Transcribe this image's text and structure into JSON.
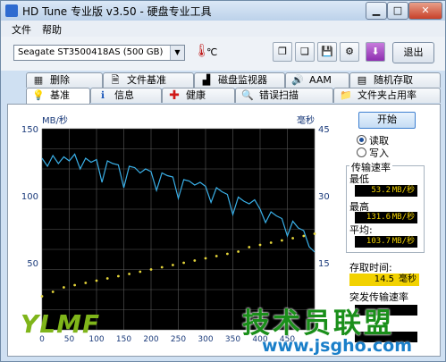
{
  "window": {
    "title": "HD Tune 专业版 v3.50 - 硬盘专业工具"
  },
  "menu": {
    "file": "文件",
    "help": "帮助"
  },
  "toolbar": {
    "drive": "Seagate ST3500418AS (500 GB)",
    "temperature_unit": "℃",
    "exit_label": "退出",
    "thermometer_icon": "thermometer-icon"
  },
  "tabs_top": [
    {
      "label": "删除",
      "icon": "delete-icon"
    },
    {
      "label": "文件基准",
      "icon": "file-benchmark-icon"
    },
    {
      "label": "磁盘监视器",
      "icon": "disk-monitor-icon"
    },
    {
      "label": "AAM",
      "icon": "speaker-icon"
    },
    {
      "label": "随机存取",
      "icon": "random-access-icon"
    }
  ],
  "tabs_bottom": [
    {
      "label": "基准",
      "icon": "bulb-icon"
    },
    {
      "label": "信息",
      "icon": "info-icon"
    },
    {
      "label": "健康",
      "icon": "health-cross-icon"
    },
    {
      "label": "错误扫描",
      "icon": "magnifier-icon"
    },
    {
      "label": "文件夹占用率",
      "icon": "folder-icon"
    }
  ],
  "side": {
    "start": "开始",
    "read": "读取",
    "write": "写入",
    "transfer_rate_title": "传输速率",
    "min_label": "最低",
    "min_value": "53.2",
    "max_label": "最高",
    "max_value": "131.6",
    "avg_label": "平均:",
    "avg_value": "103.7",
    "rate_unit": "MB/秒",
    "access_time_label": "存取时间:",
    "access_time_value": "14.5",
    "access_time_unit": "毫秒",
    "burst_rate_label": "突发传输速率"
  },
  "chart_data": {
    "type": "line",
    "left_axis_unit": "MB/秒",
    "right_axis_unit": "毫秒",
    "y_left_range": [
      0,
      150
    ],
    "y_left_ticks": [
      50,
      100,
      150
    ],
    "y_right_range": [
      0,
      45
    ],
    "y_right_ticks": [
      15,
      30,
      45
    ],
    "x_range": [
      0,
      500
    ],
    "x_ticks": [
      0,
      50,
      100,
      150,
      200,
      250,
      300,
      350,
      400,
      450
    ],
    "grid": true,
    "series": [
      {
        "role": "transfer rate (left axis)",
        "color": "#3ab0e8",
        "x": [
          0,
          10,
          20,
          30,
          40,
          50,
          60,
          70,
          80,
          90,
          100,
          110,
          120,
          130,
          140,
          150,
          160,
          170,
          180,
          190,
          200,
          210,
          220,
          230,
          240,
          250,
          260,
          270,
          280,
          290,
          300,
          310,
          320,
          330,
          340,
          350,
          360,
          370,
          380,
          390,
          400,
          410,
          420,
          430,
          440,
          450,
          460,
          470,
          480,
          490,
          500
        ],
        "y": [
          128,
          122,
          130,
          124,
          129,
          126,
          131,
          120,
          128,
          125,
          127,
          110,
          126,
          124,
          123,
          106,
          122,
          121,
          117,
          120,
          118,
          104,
          117,
          115,
          114,
          98,
          112,
          111,
          108,
          110,
          107,
          95,
          106,
          103,
          101,
          86,
          99,
          96,
          94,
          97,
          90,
          80,
          88,
          85,
          83,
          70,
          81,
          76,
          74,
          62,
          58
        ]
      },
      {
        "role": "access time (right axis)",
        "color": "#e6d63a",
        "marker": "dot",
        "x": [
          0,
          20,
          40,
          60,
          80,
          100,
          120,
          140,
          160,
          180,
          200,
          220,
          240,
          260,
          280,
          300,
          320,
          340,
          360,
          380,
          400,
          420,
          440,
          460,
          480,
          500
        ],
        "y": [
          7.5,
          8.5,
          9.5,
          10,
          10.5,
          11,
          11.5,
          12,
          12.5,
          13,
          13.5,
          14,
          14.5,
          15,
          15.5,
          16,
          16.5,
          17,
          17.5,
          18.5,
          19,
          19.5,
          20,
          20.5,
          21,
          21.5
        ]
      }
    ]
  }
}
